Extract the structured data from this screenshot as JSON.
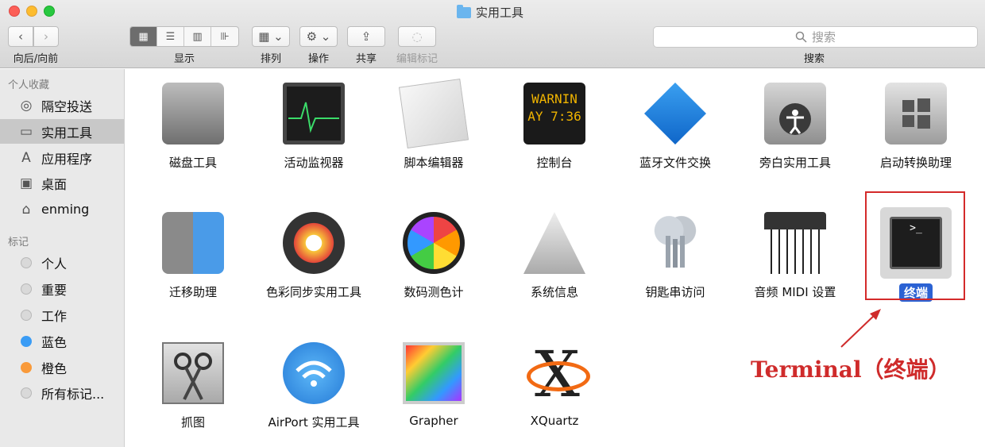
{
  "window": {
    "title": "实用工具"
  },
  "toolbar": {
    "nav_label": "向后/向前",
    "back_glyph": "‹",
    "forward_glyph": "›",
    "view_label": "显示",
    "view_glyphs": [
      "▦",
      "☰",
      "▥",
      "⊪"
    ],
    "arrange_label": "排列",
    "arrange_glyph": "▦ ⌄",
    "action_label": "操作",
    "action_glyph": "⚙ ⌄",
    "share_label": "共享",
    "share_glyph": "⇪",
    "tags_label": "编辑标记",
    "tags_glyph": "◌",
    "search_placeholder": "搜索",
    "search_label": "搜索"
  },
  "sidebar": {
    "favorites_header": "个人收藏",
    "favorites": [
      {
        "label": "隔空投送",
        "icon": "airdrop-icon",
        "glyph": "◎"
      },
      {
        "label": "实用工具",
        "icon": "folder-icon",
        "glyph": "▭"
      },
      {
        "label": "应用程序",
        "icon": "applications-icon",
        "glyph": "A"
      },
      {
        "label": "桌面",
        "icon": "desktop-icon",
        "glyph": "▣"
      },
      {
        "label": "enming",
        "icon": "home-icon",
        "glyph": "⌂"
      }
    ],
    "tags_header": "标记",
    "tags": [
      {
        "label": "个人",
        "color": "#d9d9d9"
      },
      {
        "label": "重要",
        "color": "#d9d9d9"
      },
      {
        "label": "工作",
        "color": "#d9d9d9"
      },
      {
        "label": "蓝色",
        "color": "#3a9cf5"
      },
      {
        "label": "橙色",
        "color": "#f99a3a"
      },
      {
        "label": "所有标记...",
        "color": "#d9d9d9"
      }
    ]
  },
  "apps": [
    {
      "name": "磁盘工具"
    },
    {
      "name": "活动监视器"
    },
    {
      "name": "脚本编辑器"
    },
    {
      "name": "控制台",
      "icon_text_1": "WARNIN",
      "icon_text_2": "AY 7:36"
    },
    {
      "name": "蓝牙文件交换"
    },
    {
      "name": "旁白实用工具"
    },
    {
      "name": "启动转换助理"
    },
    {
      "name": "迁移助理"
    },
    {
      "name": "色彩同步实用工具"
    },
    {
      "name": "数码测色计"
    },
    {
      "name": "系统信息"
    },
    {
      "name": "钥匙串访问"
    },
    {
      "name": "音频 MIDI 设置"
    },
    {
      "name": "终端",
      "icon_text": ">_"
    },
    {
      "name": "抓图"
    },
    {
      "name": "AirPort 实用工具"
    },
    {
      "name": "Grapher"
    },
    {
      "name": "XQuartz"
    }
  ],
  "annotation": {
    "text": "Terminal（终端）",
    "color": "#cf2b2b"
  }
}
